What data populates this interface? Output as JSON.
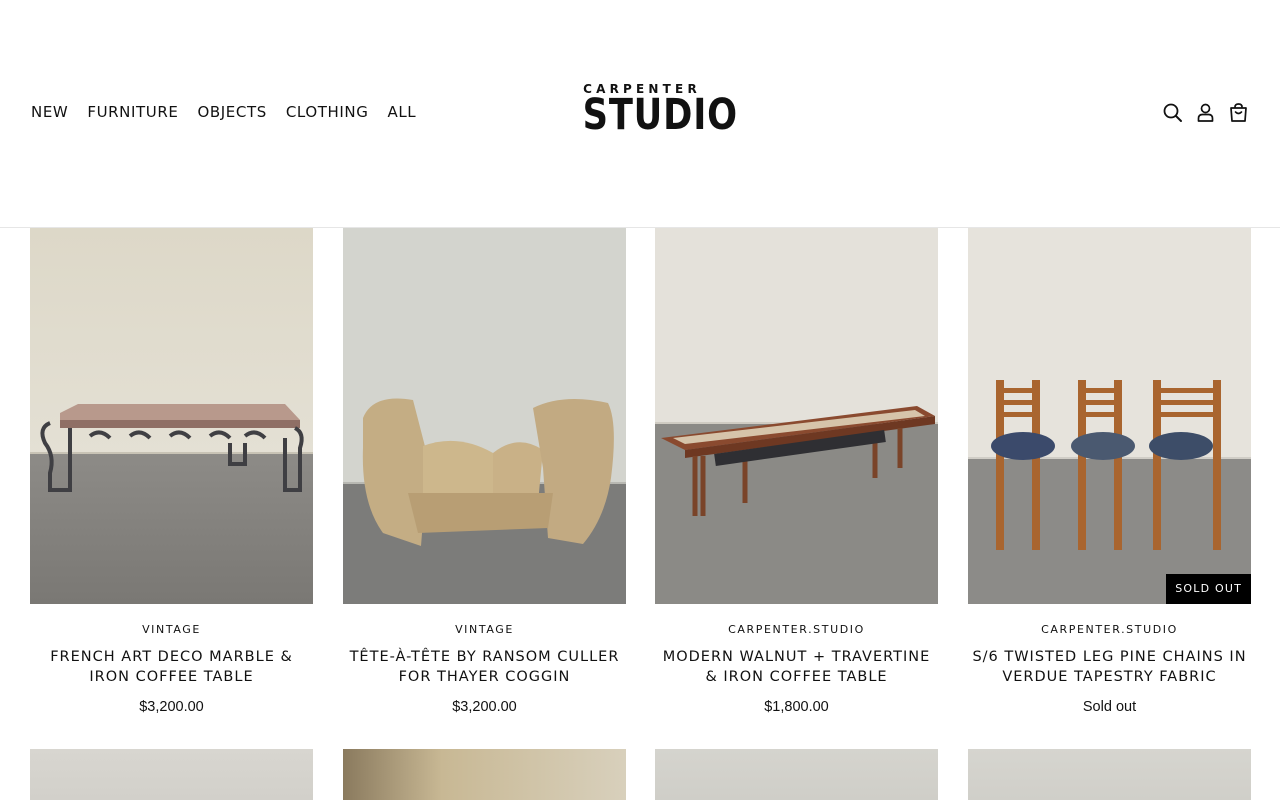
{
  "header": {
    "nav": [
      "NEW",
      "FURNITURE",
      "OBJECTS",
      "CLOTHING",
      "ALL"
    ],
    "logo_top": "CARPENTER",
    "logo_main": "STUDIO"
  },
  "products": [
    {
      "vendor": "VINTAGE",
      "title": "FRENCH ART DECO MARBLE & IRON COFFEE TABLE",
      "price": "$3,200.00"
    },
    {
      "vendor": "VINTAGE",
      "title": "TÊTE-À-TÊTE BY RANSOM CULLER FOR THAYER COGGIN",
      "price": "$3,200.00"
    },
    {
      "vendor": "CARPENTER.STUDIO",
      "title": "MODERN WALNUT + TRAVERTINE & IRON COFFEE TABLE",
      "price": "$1,800.00"
    },
    {
      "vendor": "CARPENTER.STUDIO",
      "title": "S/6 TWISTED LEG PINE CHAINS IN VERDUE TAPESTRY FABRIC",
      "price": "Sold out",
      "badge": "SOLD OUT"
    }
  ],
  "icons": [
    "search-icon",
    "account-icon",
    "cart-icon"
  ]
}
